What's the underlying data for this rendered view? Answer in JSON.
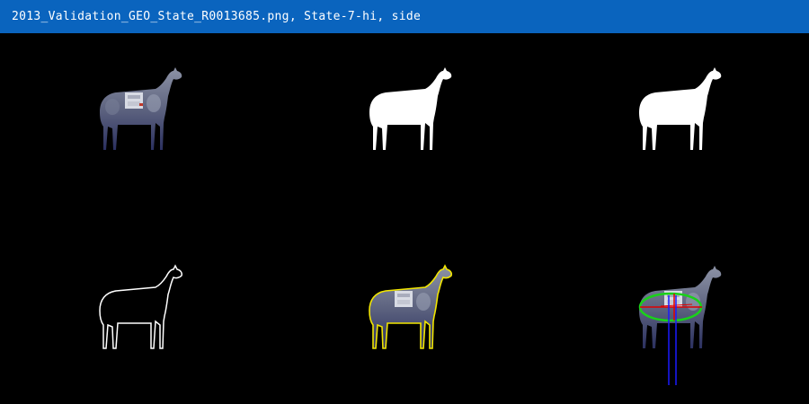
{
  "window": {
    "title": "2013_Validation_GEO_State_R0013685.png, State-7-hi, side"
  },
  "colors": {
    "titlebar_bg": "#0a64be",
    "title_text": "#ffffff",
    "background": "#000000",
    "mask_fill": "#ffffff",
    "contour_white": "#ffffff",
    "contour_yellow": "#f2e600",
    "ellipse": "#19d219",
    "centroid_axes": "#e00000",
    "leg_lines": "#1a1aff"
  },
  "panels": [
    {
      "name": "original-image",
      "icon": "goat-photo"
    },
    {
      "name": "binary-mask",
      "icon": "goat-silhouette"
    },
    {
      "name": "cleaned-mask",
      "icon": "goat-silhouette"
    },
    {
      "name": "outline-contour",
      "icon": "goat-outline"
    },
    {
      "name": "contour-overlay",
      "icon": "goat-photo-yellow-outline"
    },
    {
      "name": "ellipse-fit",
      "icon": "goat-photo-ellipse"
    }
  ]
}
